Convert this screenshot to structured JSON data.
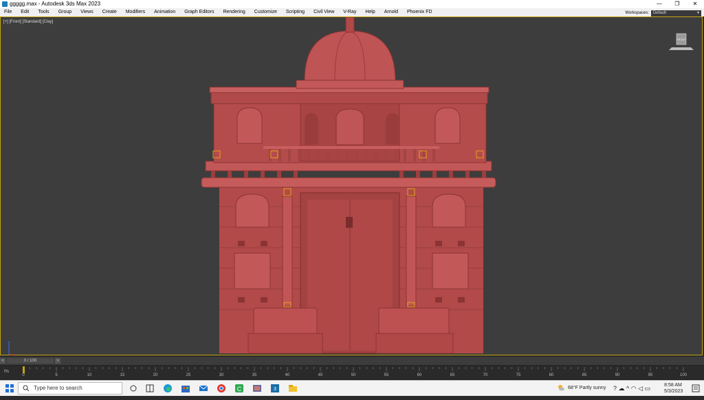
{
  "window": {
    "title": "ggggg.max - Autodesk 3ds Max 2023",
    "controls": [
      "—",
      "❐",
      "✕"
    ]
  },
  "menu": [
    "File",
    "Edit",
    "Tools",
    "Group",
    "Views",
    "Create",
    "Modifiers",
    "Animation",
    "Graph Editors",
    "Rendering",
    "Customize",
    "Scripting",
    "Civil View",
    "V-Ray",
    "Help",
    "Arnold",
    "Phoenix FD"
  ],
  "workspaces": {
    "label": "Workspaces:",
    "value": "Default"
  },
  "viewport": {
    "label": "[+] [Front] [Standard] [Clay]",
    "filter_icon": "funnel-icon"
  },
  "colors": {
    "model_fill": "#b84d4d",
    "model_dark": "#8c3434",
    "model_light": "#d26a6a",
    "viewport_bg": "#3d3d3d",
    "selection": "#e3a51a"
  },
  "timeline": {
    "frame": "0 / 100",
    "prev": "<",
    "next": ">"
  },
  "trackbar": {
    "ticks": [
      "0",
      "5",
      "10",
      "15",
      "20",
      "25",
      "30",
      "35",
      "40",
      "45",
      "50",
      "55",
      "60",
      "65",
      "70",
      "75",
      "80",
      "85",
      "90",
      "95",
      "100"
    ],
    "fps_label": "f%"
  },
  "taskbar": {
    "search_placeholder": "Type here to search",
    "weather": "68°F  Partly sunny",
    "time": "8:58 AM",
    "date": "5/3/2023"
  }
}
